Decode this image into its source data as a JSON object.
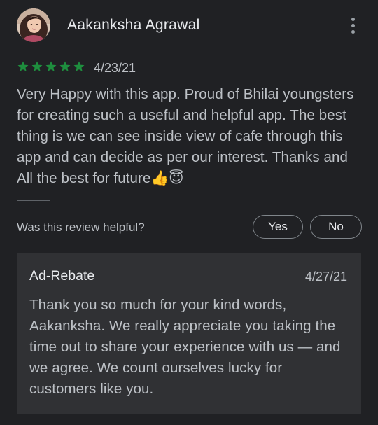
{
  "review": {
    "author": "Aakanksha Agrawal",
    "rating": 5,
    "rating_max": 5,
    "date": "4/23/21",
    "text": "Very Happy with this app. Proud of Bhilai youngsters for creating such a useful and helpful app. The best thing is we can see inside view of cafe through this app and can decide as per our interest. Thanks and All the best for future👍😇",
    "star_color": "#1e8e3e",
    "avatar_icon": "user-photo-avatar",
    "menu_icon": "more-vertical-icon"
  },
  "helpful": {
    "question": "Was this review helpful?",
    "yes_label": "Yes",
    "no_label": "No"
  },
  "reply": {
    "author": "Ad-Rebate",
    "date": "4/27/21",
    "text": "Thank you so much for your kind words, Aakanksha. We really appreciate you taking the time out to share your experience with us — and we agree. We count ourselves lucky for customers like you."
  }
}
